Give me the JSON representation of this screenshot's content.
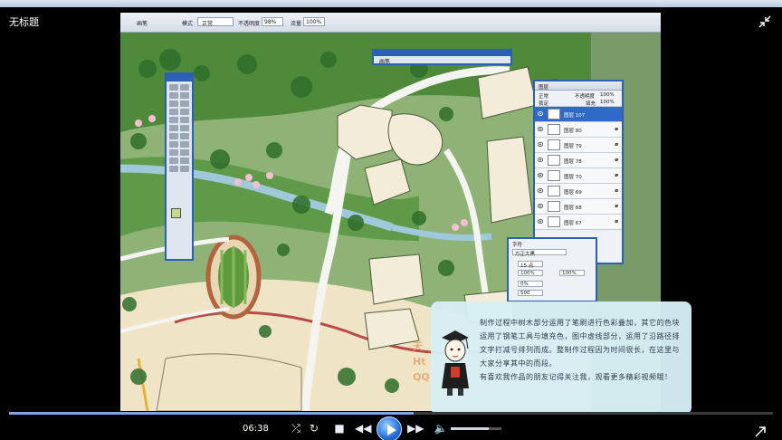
{
  "window": {
    "title": "无标题"
  },
  "player": {
    "time": "06:38",
    "progress": 0.53,
    "volume": 0.75,
    "icons": [
      "shuffle-icon",
      "repeat-icon",
      "stop-icon",
      "rewind-icon",
      "play-icon",
      "fast-forward-icon",
      "volume-icon",
      "expand-icon",
      "shrink-icon"
    ]
  },
  "photoshop": {
    "toolbar": {
      "brush_label": "画笔",
      "mode_label": "模式",
      "mode_value": "正常",
      "opacity_label": "不透明度",
      "opacity_value": "98%",
      "flow_label": "流量",
      "flow_value": "100%"
    },
    "brush_panel_label": "画笔",
    "layers_panel": {
      "tab_label": "图层",
      "blend_mode": "正常",
      "opacity_label": "不透明度",
      "opacity_value": "100%",
      "lock_label": "锁定",
      "fill_label": "填充",
      "fill_value": "100%",
      "layers": [
        {
          "name": "图层 107",
          "selected": true
        },
        {
          "name": "图层 80",
          "selected": false
        },
        {
          "name": "图层 79",
          "selected": false
        },
        {
          "name": "图层 78",
          "selected": false
        },
        {
          "name": "图层 70",
          "selected": false
        },
        {
          "name": "图层 69",
          "selected": false
        },
        {
          "name": "图层 68",
          "selected": false
        },
        {
          "name": "图层 67",
          "selected": false
        }
      ]
    },
    "character_panel": {
      "tab_label": "字符",
      "font_family": "方正大黑",
      "size_value": "15 点",
      "scale_v": "100%",
      "scale_h": "100%",
      "tracking": "0%",
      "kerning": "500",
      "baseline": "0 点"
    }
  },
  "annotation": {
    "paragraph1": "制作过程中树木部分运用了笔刷进行色彩叠加，其它的色块运用了钢笔工具与填充色，图中虚线部分，运用了沿路径排文字打减号排列而成。整制作过程因为时间很长，在这里与大家分享其中的而段。",
    "paragraph2": "有喜欢我作品的朋友记得关注我，观看更多精彩视频哦！",
    "watermark_lines": [
      "天",
      "Ht",
      "QQ"
    ]
  },
  "colors": {
    "accent": "#2d5fb7",
    "layer_selected": "#3169c6",
    "progress_fill": "#7da7e6",
    "note_bg": "#d6eef5"
  }
}
